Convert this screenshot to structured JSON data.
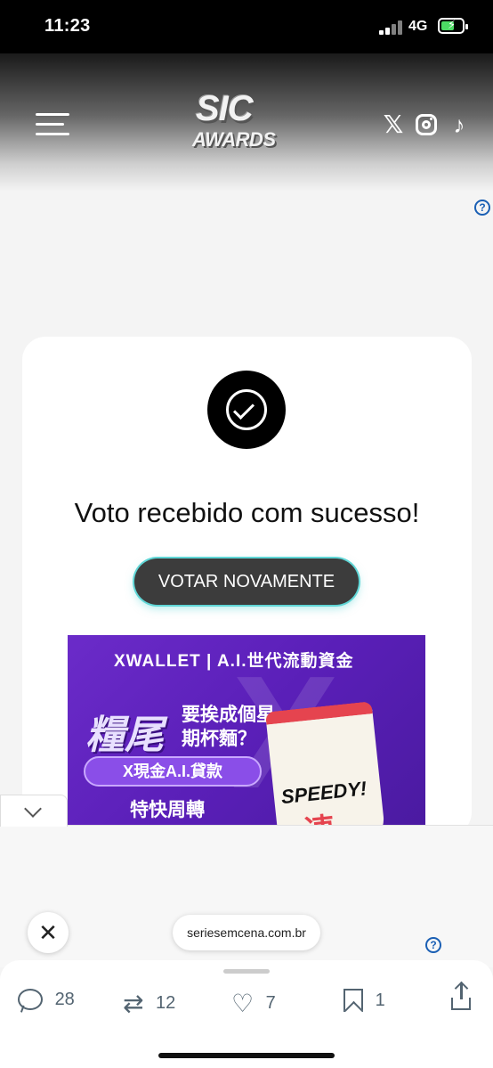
{
  "status_bar": {
    "time": "11:23",
    "network": "4G"
  },
  "header": {
    "logo_line1": "SIC",
    "logo_line2": "AWARDS",
    "icons": [
      "menu-icon",
      "x-icon",
      "instagram-icon",
      "tiktok-icon"
    ]
  },
  "vote_card": {
    "message": "Voto recebido com sucesso!",
    "vote_again_label": "VOTAR NOVAMENTE"
  },
  "ad": {
    "brand": "XWALLET | A.I.世代流動資金",
    "headline_big": "糧尾",
    "headline_small": "要挨成個星期杯麵？",
    "pill": "X現金A.I.貸款",
    "sub": "特快周轉",
    "cup_label": "SPEEDY!",
    "cup_char": "速"
  },
  "browser": {
    "url": "seriesemcena.com.br",
    "close_symbol": "✕",
    "help_symbol": "?"
  },
  "actions": {
    "replies": "28",
    "reposts": "12",
    "likes": "7",
    "bookmarks": "1"
  },
  "colors": {
    "accent_glow": "#5fd6d6",
    "ad_purple": "#5a1fb8",
    "link_blue": "#1a5fb4",
    "icon_gray": "#536471"
  }
}
